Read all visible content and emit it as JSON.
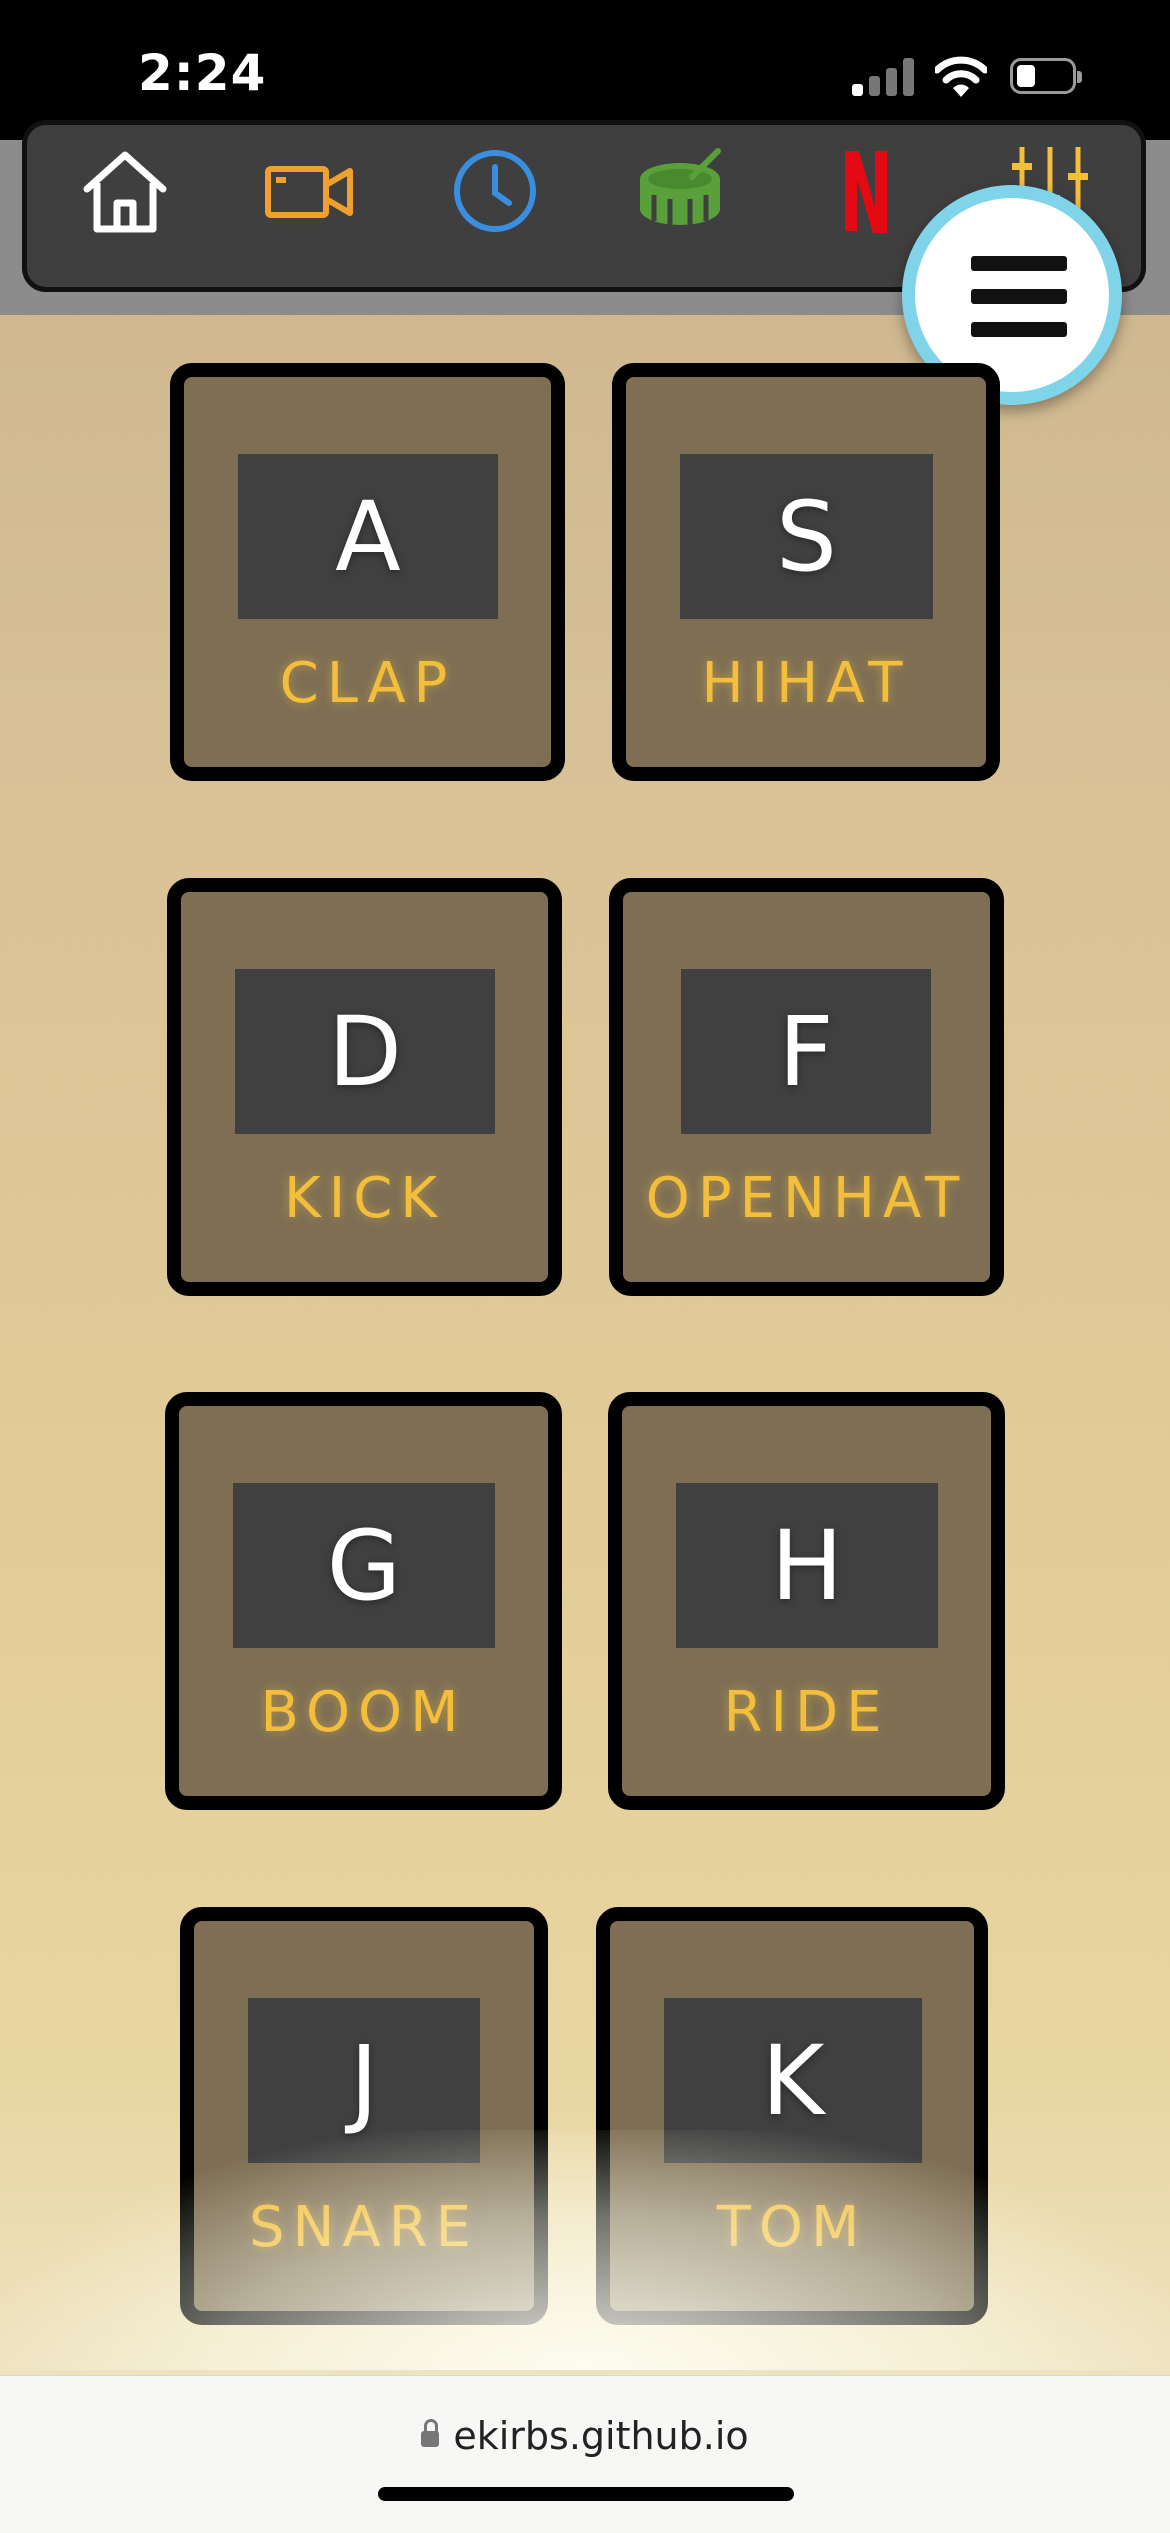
{
  "status_bar": {
    "time": "2:24",
    "signal_bars_active": 1,
    "battery_level": 0.3
  },
  "toolbar": {
    "icons": [
      {
        "name": "home-icon",
        "color": "#ffffff"
      },
      {
        "name": "video-camera-icon",
        "color": "#f0a030"
      },
      {
        "name": "clock-icon",
        "color": "#3a8ee0"
      },
      {
        "name": "drum-icon",
        "color": "#5aa03a"
      },
      {
        "name": "netflix-icon",
        "color": "#e50914"
      },
      {
        "name": "sliders-icon",
        "color": "#f2be3c"
      }
    ]
  },
  "menu_button": {
    "icon": "hamburger-icon",
    "ring_color": "#7fd4ea"
  },
  "drum_keys": [
    {
      "key": "A",
      "sound": "CLAP"
    },
    {
      "key": "S",
      "sound": "HIHAT"
    },
    {
      "key": "D",
      "sound": "KICK"
    },
    {
      "key": "F",
      "sound": "OPENHAT"
    },
    {
      "key": "G",
      "sound": "BOOM"
    },
    {
      "key": "H",
      "sound": "RIDE"
    },
    {
      "key": "J",
      "sound": "SNARE"
    },
    {
      "key": "K",
      "sound": "TOM"
    }
  ],
  "browser": {
    "url": "ekirbs.github.io"
  },
  "colors": {
    "key_bg": "#7e6f54",
    "letter_box": "#404040",
    "sound_label": "#f2be3c"
  }
}
